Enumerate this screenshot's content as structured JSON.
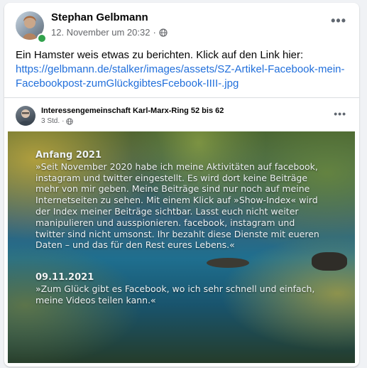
{
  "post": {
    "author": "Stephan Gelbmann",
    "timestamp": "12. November um 20:32",
    "separator": "·",
    "privacy_icon": "globe-icon",
    "more_label": "•••",
    "text": "Ein Hamster weis etwas zu berichten. Klick auf den Link hier:",
    "link": "https://gelbmann.de/stalker/images/assets/SZ-Artikel-Facebook-mein-Facebookpost-zumGlückgibtesFcebook-IIII-.jpg"
  },
  "shared": {
    "page_name": "Interessengemeinschaft Karl-Marx-Ring 52 bis 62",
    "time": "3 Std.",
    "separator": "·",
    "privacy_icon": "globe-icon",
    "more_label": "•••",
    "image": {
      "block1_date": "Anfang 2021",
      "block1_text": "»Seit November 2020 habe ich meine Aktivitäten auf facebook, instagram und twitter eingestellt. Es wird dort keine Beiträge mehr von mir geben. Meine Beiträge sind nur noch auf meine Internetseiten zu sehen. Mit einem Klick auf »Show-Index« wird der Index meiner Beiträge sichtbar. Lasst euch nicht weiter manipulieren und ausspionieren. facebook, instagram und twitter sind nicht umsonst. Ihr bezahlt diese Dienste mit eueren Daten – und das für den Rest eures Lebens.«",
      "block2_date": "09.11.2021",
      "block2_text": "»Zum Glück gibt es Facebook, wo ich sehr schnell und einfach, meine Videos teilen kann.«"
    }
  },
  "colors": {
    "link": "#216fdb",
    "online": "#31a24c",
    "background": "#f0f2f5"
  }
}
